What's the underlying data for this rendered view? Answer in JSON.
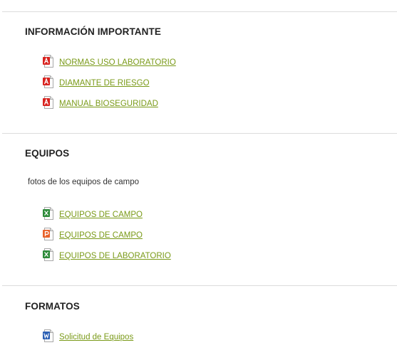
{
  "sections": [
    {
      "title": "INFORMACIÓN IMPORTANTE",
      "files": [
        {
          "label": "NORMAS USO LABORATORIO",
          "icon": "pdf-icon"
        },
        {
          "label": "DIAMANTE DE RIESGO",
          "icon": "pdf-icon"
        },
        {
          "label": "MANUAL BIOSEGURIDAD",
          "icon": "pdf-icon"
        }
      ]
    },
    {
      "title": "EQUIPOS",
      "description": "fotos de los equipos de campo",
      "files": [
        {
          "label": "EQUIPOS DE CAMPO",
          "icon": "excel-icon"
        },
        {
          "label": "EQUIPOS DE CAMPO",
          "icon": "powerpoint-icon"
        },
        {
          "label": "EQUIPOS DE LABORATORIO",
          "icon": "excel-icon"
        }
      ]
    },
    {
      "title": "FORMATOS",
      "files": [
        {
          "label": "Solicitud de Equipos",
          "icon": "word-icon"
        }
      ]
    }
  ],
  "colors": {
    "link": "#7a9a18",
    "pdf": "#d8231f",
    "excel": "#2e8b3a",
    "powerpoint": "#e8622b",
    "word": "#2b5fb4"
  }
}
